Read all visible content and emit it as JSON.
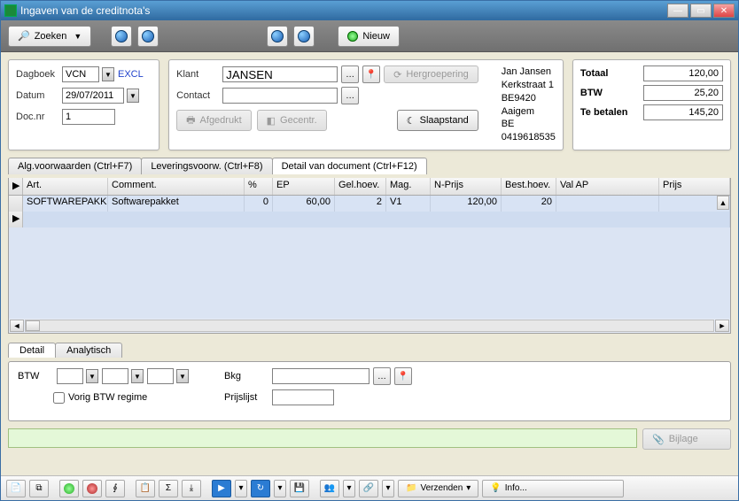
{
  "window": {
    "title": "Ingaven van de creditnota's"
  },
  "toolbar": {
    "zoeken": "Zoeken",
    "nieuw": "Nieuw"
  },
  "header": {
    "dagboek_label": "Dagboek",
    "dagboek_value": "VCN",
    "excl": "EXCL",
    "datum_label": "Datum",
    "datum_value": "29/07/2011",
    "docnr_label": "Doc.nr",
    "docnr_value": "1",
    "klant_label": "Klant",
    "klant_value": "JANSEN",
    "contact_label": "Contact",
    "contact_value": "",
    "hergroepering": "Hergroepering",
    "afgedrukt": "Afgedrukt",
    "gecentr": "Gecentr.",
    "slaapstand": "Slaapstand",
    "address": {
      "name": "Jan Jansen",
      "street": "Kerkstraat 1",
      "city": "BE9420 Aaigem",
      "vat": "BE 0419618535"
    }
  },
  "totals": {
    "totaal_label": "Totaal",
    "totaal_value": "120,00",
    "btw_label": "BTW",
    "btw_value": "25,20",
    "tebetalen_label": "Te betalen",
    "tebetalen_value": "145,20"
  },
  "tabs": {
    "alg": "Alg.voorwaarden (Ctrl+F7)",
    "lev": "Leveringsvoorw. (Ctrl+F8)",
    "det": "Detail van document (Ctrl+F12)"
  },
  "grid": {
    "headers": {
      "art": "Art.",
      "comment": "Comment.",
      "pct": "%",
      "ep": "EP",
      "gelhoev": "Gel.hoev.",
      "mag": "Mag.",
      "nprijs": "N-Prijs",
      "besthoev": "Best.hoev.",
      "valap": "Val AP",
      "prijs": "Prijs"
    },
    "rows": [
      {
        "art": "SOFTWAREPAKKE",
        "comment": "Softwarepakket",
        "pct": "0",
        "ep": "60,00",
        "gelhoev": "2",
        "mag": "V1",
        "nprijs": "120,00",
        "besthoev": "20",
        "valap": "",
        "prijs": ""
      }
    ]
  },
  "detail": {
    "tab_detail": "Detail",
    "tab_analytisch": "Analytisch",
    "btw_label": "BTW",
    "vorig": "Vorig BTW regime",
    "bkg_label": "Bkg",
    "prijslijst_label": "Prijslijst"
  },
  "bijlage": "Bijlage",
  "status": {
    "verzenden": "Verzenden",
    "info": "Info..."
  }
}
